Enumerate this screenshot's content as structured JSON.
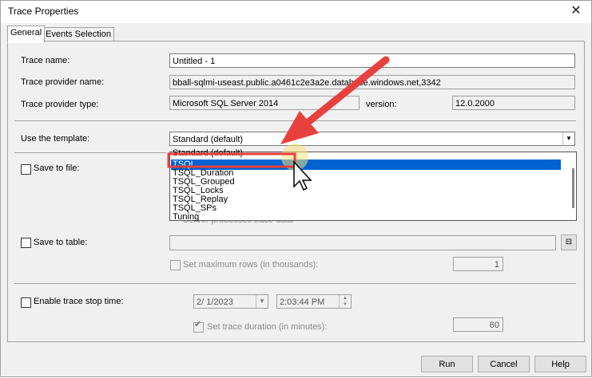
{
  "window": {
    "title": "Trace Properties",
    "close_glyph": "✕"
  },
  "tabs": [
    {
      "label": "General"
    },
    {
      "label": "Events Selection"
    }
  ],
  "general": {
    "trace_name_label": "Trace name:",
    "trace_name_value": "Untitled - 1",
    "provider_name_label": "Trace provider name:",
    "provider_name_value": "bball-sqlmi-useast.public.a0461c2e3a2e.database.windows.net,3342",
    "provider_type_label": "Trace provider type:",
    "provider_type_value": "Microsoft SQL Server 2014",
    "version_label": "version:",
    "version_value": "12.0.2000",
    "template_label": "Use the template:",
    "template_value": "Standard (default)",
    "template_options": [
      "Standard (default)",
      "TSQL",
      "TSQL_Duration",
      "TSQL_Grouped",
      "TSQL_Locks",
      "TSQL_Replay",
      "TSQL_SPs",
      "Tuning"
    ],
    "template_selected": "TSQL",
    "save_to_file_label": "Save to file:",
    "server_processes_label": "Server processes trace data",
    "save_to_table_label": "Save to table:",
    "set_max_rows_label": "Set maximum rows (in thousands):",
    "max_rows_value": "1",
    "enable_stop_label": "Enable trace stop time:",
    "stop_date_value": "2/  1/2023",
    "stop_time_value": "2:03:44 PM",
    "set_duration_label": "Set trace duration (in minutes):",
    "duration_value": "60"
  },
  "buttons": {
    "run": "Run",
    "cancel": "Cancel",
    "help": "Help"
  },
  "annotation": {
    "arrow_color": "#e8403c",
    "highlight_color": "#e8403c"
  }
}
